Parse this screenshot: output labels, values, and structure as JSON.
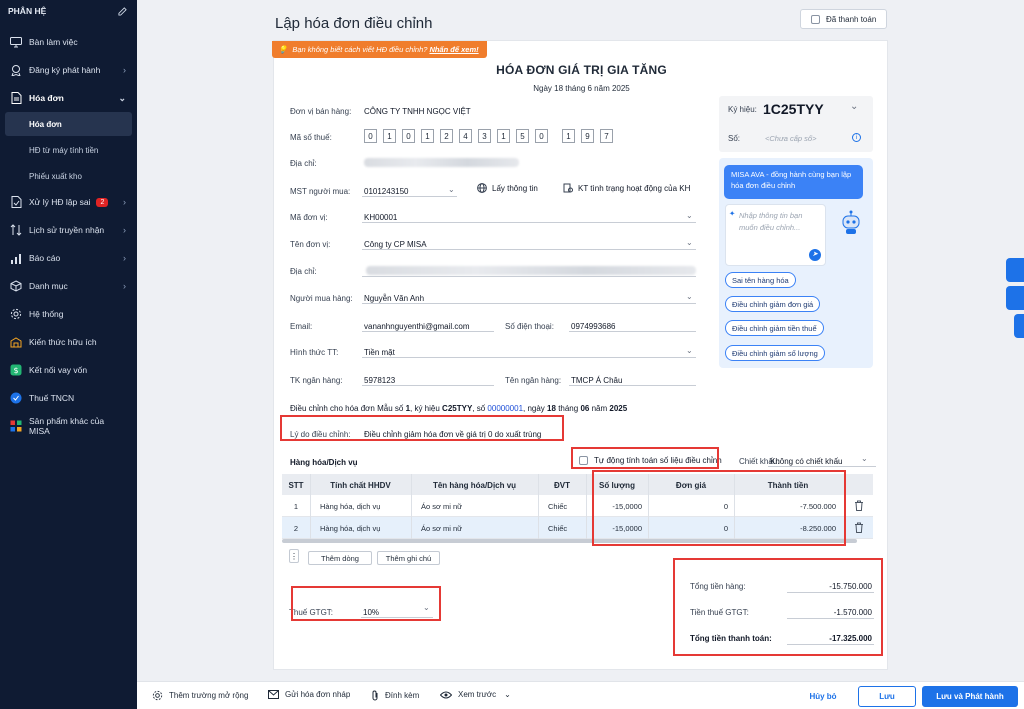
{
  "sidebar": {
    "header": "PHÂN HỆ",
    "items": [
      {
        "label": "Bàn làm việc",
        "icon": "monitor-icon",
        "chevron": false
      },
      {
        "label": "Đăng ký phát hành",
        "icon": "register-icon",
        "chevron": true
      },
      {
        "label": "Hóa đơn",
        "icon": "invoice-icon",
        "chevron": true,
        "expanded": true
      },
      {
        "label": "Xử lý HĐ lập sai",
        "icon": "fix-icon",
        "chevron": true,
        "badge": "2"
      },
      {
        "label": "Lịch sử truyền nhận",
        "icon": "history-icon",
        "chevron": true
      },
      {
        "label": "Báo cáo",
        "icon": "chart-icon",
        "chevron": true
      },
      {
        "label": "Danh mục",
        "icon": "box-icon",
        "chevron": true
      },
      {
        "label": "Hệ thống",
        "icon": "gear-icon",
        "chevron": false
      },
      {
        "label": "Kiến thức hữu ích",
        "icon": "knowledge-icon",
        "chevron": false
      },
      {
        "label": "Kết nối vay vốn",
        "icon": "loan-icon",
        "chevron": false
      },
      {
        "label": "Thuế TNCN",
        "icon": "tax-icon",
        "chevron": false
      },
      {
        "label": "Sản phẩm khác của MISA",
        "icon": "apps-icon",
        "chevron": false
      }
    ],
    "sub_items": [
      "Hóa đơn",
      "HĐ từ máy tính tiền",
      "Phiếu xuất kho"
    ]
  },
  "header": {
    "title": "Lập hóa đơn điều chỉnh",
    "paid_label": "Đã thanh toán"
  },
  "invoice": {
    "hint_text": "Bạn không biết cách viết HĐ điều chỉnh",
    "hint_link": "Nhấn để xem!",
    "title": "HÓA ĐƠN GIÁ TRỊ GIA TĂNG",
    "date": "Ngày 18 tháng 6 năm 2025",
    "seller_label": "Đơn vị bán hàng:",
    "seller": "CÔNG TY TNHH NGỌC VIỆT",
    "tax_code_label": "Mã số thuế:",
    "tax_code_digits": [
      "0",
      "1",
      "0",
      "1",
      "2",
      "4",
      "3",
      "1",
      "5",
      "0",
      "",
      "1",
      "9",
      "7"
    ],
    "address_label": "Địa chỉ:",
    "buyer_tax_label": "MST người mua:",
    "buyer_tax": "0101243150",
    "lookup_label": "Lấy thông tin",
    "check_label": "KT tình trạng hoạt động của KH",
    "unit_code_label": "Mã đơn vị:",
    "unit_code": "KH00001",
    "unit_name_label": "Tên đơn vị:",
    "unit_name": "Công ty CP MISA",
    "address2_label": "Địa chỉ:",
    "buyer_label": "Người mua hàng:",
    "buyer": "Nguyễn Văn Anh",
    "email_label": "Email:",
    "email": "vananhnguyenthi@gmail.com",
    "phone_label": "Số điện thoại:",
    "phone": "0974993686",
    "payment_label": "Hình thức TT:",
    "payment": "Tiền mặt",
    "bank_acc_label": "TK ngân hàng:",
    "bank_acc": "5978123",
    "bank_name_label": "Tên ngân hàng:",
    "bank_name": "TMCP Á Châu",
    "adjust_prefix": "Điều chỉnh cho hóa đơn Mẫu số",
    "adjust_form": "1",
    "adjust_sym_label": ", ký hiệu",
    "adjust_sym": "C25TYY",
    "adjust_no_label": ", số",
    "adjust_no": "00000001",
    "adjust_day_label": ", ngày",
    "adjust_day": "18",
    "adjust_month_label": "tháng",
    "adjust_month": "06",
    "adjust_year_label": "năm",
    "adjust_year": "2025",
    "reason_label": "Lý do điều chỉnh:",
    "reason": "Điều chỉnh giảm hóa đơn về giá trị 0 do xuất trùng"
  },
  "symbol_panel": {
    "symbol_label": "Ký hiệu:",
    "symbol": "1C25TYY",
    "number_label": "Số:",
    "number_placeholder": "<Chưa cấp số>"
  },
  "ai_panel": {
    "bubble": "MISA AVA - đồng hành cùng bạn lập hóa đơn điều chỉnh",
    "input_placeholder": "Nhập thông tin bạn muốn điều chỉnh...",
    "chips": [
      "Sai tên hàng hóa",
      "Điều chỉnh giảm đơn giá",
      "Điều chỉnh giảm tiền thuế",
      "Điều chỉnh giảm số lượng"
    ]
  },
  "goods": {
    "section_label": "Hàng hóa/Dịch vụ",
    "auto_calc_label": "Tự động tính toán số liệu điều chỉnh",
    "discount_label": "Chiết khấu:",
    "discount": "Không có chiết khấu",
    "columns": [
      "STT",
      "Tính chất HHDV",
      "Tên hàng hóa/Dịch vụ",
      "ĐVT",
      "Số lượng",
      "Đơn giá",
      "Thành tiền"
    ],
    "rows": [
      {
        "stt": "1",
        "type": "Hàng hóa, dịch vụ",
        "name": "Áo sơ mi nữ",
        "unit": "Chiếc",
        "qty": "-15,0000",
        "price": "0",
        "amount": "-7.500.000"
      },
      {
        "stt": "2",
        "type": "Hàng hóa, dịch vụ",
        "name": "Áo sơ mi nữ",
        "unit": "Chiếc",
        "qty": "-15,0000",
        "price": "0",
        "amount": "-8.250.000"
      }
    ],
    "add_row": "Thêm dòng",
    "add_note": "Thêm ghi chú"
  },
  "totals": {
    "vat_label": "Thuế GTGT:",
    "vat": "10%",
    "goods_label": "Tổng tiền hàng:",
    "goods_total": "-15.750.000",
    "vat_amount_label": "Tiền thuế GTGT:",
    "vat_amount": "-1.570.000",
    "pay_label": "Tổng tiền thanh toán:",
    "pay_total": "-17.325.000"
  },
  "footer": {
    "extra_fields": "Thêm trường mở rộng",
    "send_draft": "Gửi hóa đơn nháp",
    "attach": "Đính kèm",
    "preview": "Xem trước",
    "cancel": "Hủy bỏ",
    "save": "Lưu",
    "save_issue": "Lưu và Phát hành"
  },
  "colors": {
    "sidebar": "#0f1b33",
    "primary": "#1d72e8",
    "highlight": "#e53935",
    "hint": "#f07d2c"
  }
}
